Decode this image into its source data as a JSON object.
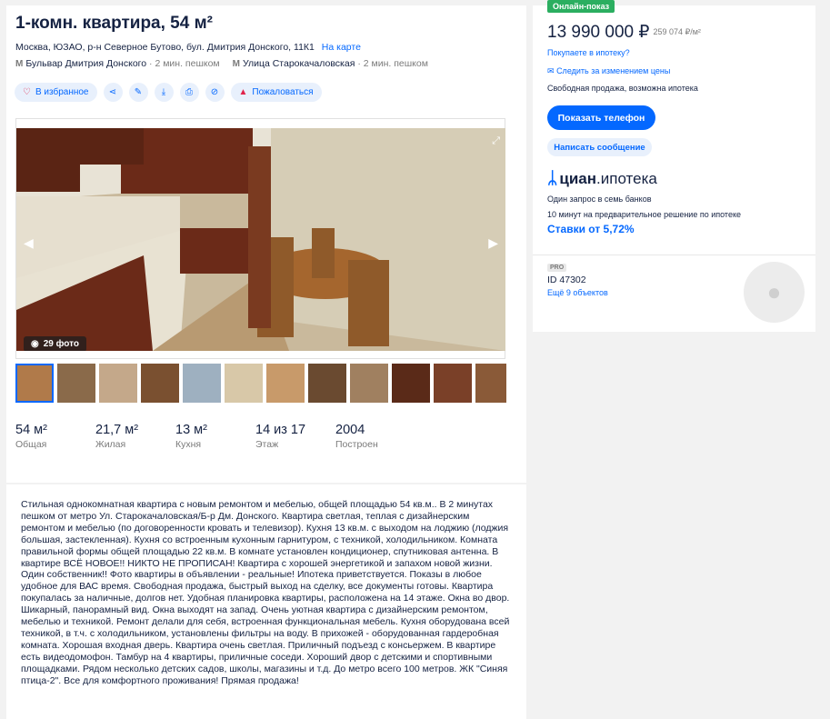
{
  "title": "1-комн. квартира, 54 м²",
  "address": {
    "text": "Москва, ЮЗАО, р-н Северное Бутово, бул. Дмитрия Донского, 11К1",
    "map_link": "На карте"
  },
  "metro": [
    {
      "name": "Бульвар Дмитрия Донского",
      "time": "· 2 мин. пешком"
    },
    {
      "name": "Улица Старокачаловская",
      "time": "· 2 мин. пешком"
    }
  ],
  "actions": {
    "favorite": "В избранное",
    "complain": "Пожаловаться"
  },
  "photo": {
    "count": "29 фото"
  },
  "stats": [
    {
      "value": "54 м²",
      "label": "Общая"
    },
    {
      "value": "21,7 м²",
      "label": "Жилая"
    },
    {
      "value": "13 м²",
      "label": "Кухня"
    },
    {
      "value": "14 из 17",
      "label": "Этаж"
    },
    {
      "value": "2004",
      "label": "Построен"
    }
  ],
  "description": "Стильная однокомнатная квартира с новым ремонтом и мебелью, общей площадью 54 кв.м.. В 2 минутах пешком от метро Ул. Старокачаловская/Б-р Дм. Донского. Квартира светлая, теплая с дизайнерским ремонтом и мебелью (по договоренности кровать и телевизор). Кухня 13 кв.м. с выходом на лоджию (лоджия большая, застекленная). Кухня со встроенным кухонным гарнитуром, с техникой, холодильником. Комната правильной формы общей площадью 22 кв.м. В комнате установлен кондиционер, спутниковая антенна. В квартире ВСЁ НОВОЕ!! НИКТО НЕ ПРОПИСАН! Квартира с хорошей энергетикой и запахом новой жизни. Один собственник!! Фото квартиры в объявлении - реальные! Ипотека приветствуется. Показы в любое удобное для ВАС время. Свободная продажа, быстрый выход на сделку, все документы готовы. Квартира покупалась за наличные, долгов нет. Удобная планировка квартиры, расположена на 14 этаже. Окна во двор. Шикарный, панорамный вид. Окна выходят на запад. Очень уютная квартира с дизайнерским ремонтом, мебелью и техникой. Ремонт делали для себя, встроенная функциональная мебель. Кухня оборудована всей техникой, в т.ч. с холодильником, установлены фильтры на воду. В прихожей - оборудованная гардеробная комната. Хорошая входная дверь. Квартира очень светлая. Приличный подъезд с консьержем. В квартире есть видеодомофон. Тамбур на 4 квартиры, приличные соседи. Хороший двор с детскими и спортивными площадками. Рядом несколько детских садов, школы, магазины и т.д. До метро всего 100 метров. ЖК \"Синяя птица-2\". Все для комфортного проживания! Прямая продажа!",
  "sidebar": {
    "badge": "Онлайн-показ",
    "price": "13 990 000 ₽",
    "price_per_m": "259 074 ₽/м²",
    "mortgage_link": "Покупаете в ипотеку?",
    "watch_link": "Следить за изменением цены",
    "sale_terms": "Свободная продажа, возможна ипотека",
    "phone_button": "Показать телефон",
    "message_button": "Написать сообщение",
    "logo_brand": "циан",
    "logo_product": ".ипотека",
    "mortgage_line1": "Один запрос в семь банков",
    "mortgage_line2": "10 минут на предварительное решение по ипотеке",
    "rate": "Ставки от 5,72%",
    "pro_badge": "PRO",
    "agent_id": "ID 47302",
    "more_objects": "Ещё 9 объектов"
  }
}
